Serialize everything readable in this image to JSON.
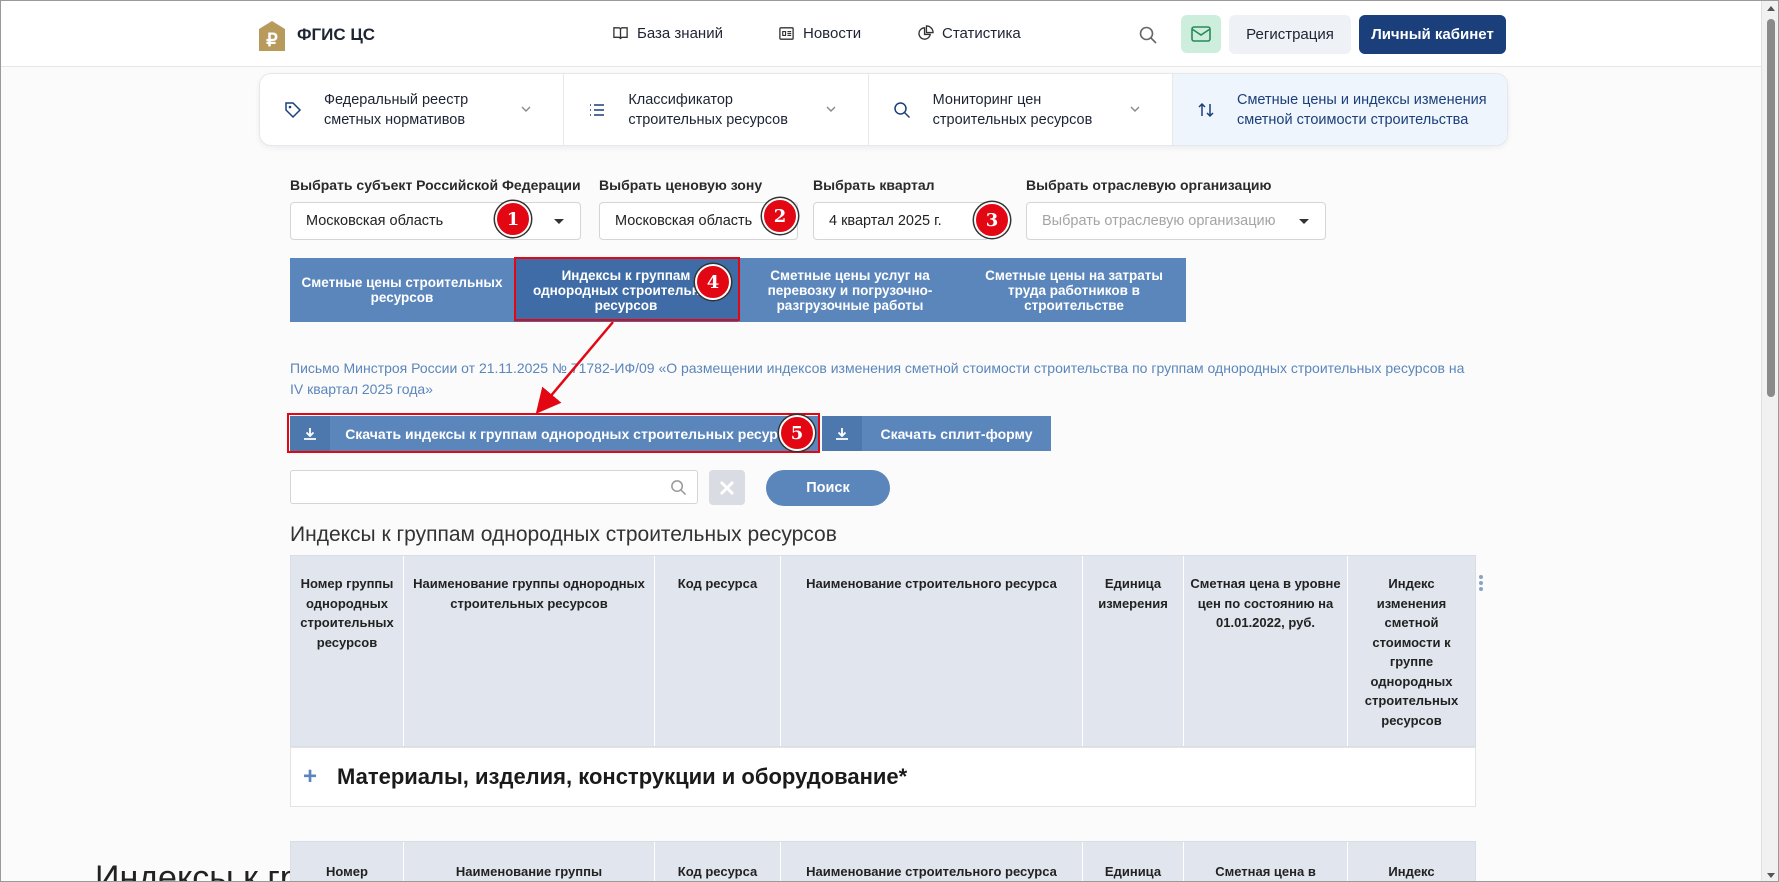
{
  "header": {
    "brand": "ФГИС ЦС",
    "nav": [
      {
        "label": "База знаний",
        "icon": "book-icon"
      },
      {
        "label": "Новости",
        "icon": "news-icon"
      },
      {
        "label": "Статистика",
        "icon": "chart-pie-icon"
      }
    ],
    "register_label": "Регистрация",
    "cabinet_label": "Личный кабинет"
  },
  "sections": [
    {
      "label": "Федеральный реестр сметных нормативов",
      "icon": "tag-icon"
    },
    {
      "label": "Классификатор строительных ресурсов",
      "icon": "list-icon"
    },
    {
      "label": "Мониторинг цен строительных ресурсов",
      "icon": "search-icon"
    },
    {
      "label": "Сметные цены и индексы изменения сметной стоимости строительства",
      "icon": "sort-arrows-icon"
    }
  ],
  "filters": {
    "subject_label": "Выбрать субъект Российской Федерации",
    "subject_value": "Московская область",
    "zone_label": "Выбрать ценовую зону",
    "zone_value": "Московская область",
    "quarter_label": "Выбрать квартал",
    "quarter_value": "4 квартал 2025 г.",
    "org_label": "Выбрать отраслевую организацию",
    "org_placeholder": "Выбрать отраслевую организацию"
  },
  "badges": [
    "1",
    "2",
    "3",
    "4",
    "5"
  ],
  "tabs": [
    "Сметные цены строительных ресурсов",
    "Индексы к группам однородных строительных ресурсов",
    "Сметные цены услуг на перевозку и погрузочно-разгрузочные работы",
    "Сметные цены на затраты труда работников в строительстве"
  ],
  "letter": "Письмо Минстроя России от 21.11.2025 № 71782-ИФ/09 «О размещении индексов изменения сметной стоимости строительства по группам однородных строительных ресурсов на IV квартал 2025 года»",
  "downloads": {
    "indexes_label": "Скачать индексы к группам однородных строительных ресурсов",
    "split_label": "Скачать сплит-форму"
  },
  "search": {
    "placeholder": "",
    "button_label": "Поиск"
  },
  "table": {
    "title": "Индексы к группам однородных строительных ресурсов",
    "columns": [
      "Номер группы однородных строительных ресурсов",
      "Наименование группы однородных строительных ресурсов",
      "Код ресурса",
      "Наименование строительного ресурса",
      "Единица измерения",
      "Сметная цена в уровне цен по состоянию на 01.01.2022, руб.",
      "Индекс изменения сметной стоимости к группе однородных строительных ресурсов"
    ],
    "group_row": "Материалы, изделия, конструкции и оборудование*",
    "columns2": [
      "Номер",
      "Наименование группы",
      "Код ресурса",
      "Наименование строительного ресурса",
      "Единица",
      "Сметная цена в",
      "Индекс"
    ]
  },
  "background_heading": "Индексы к группам однородных строительных ресурсов",
  "colors": {
    "primary": "#1b3f7a",
    "tab_blue": "#5b86bc",
    "annotation_red": "#e30613"
  }
}
